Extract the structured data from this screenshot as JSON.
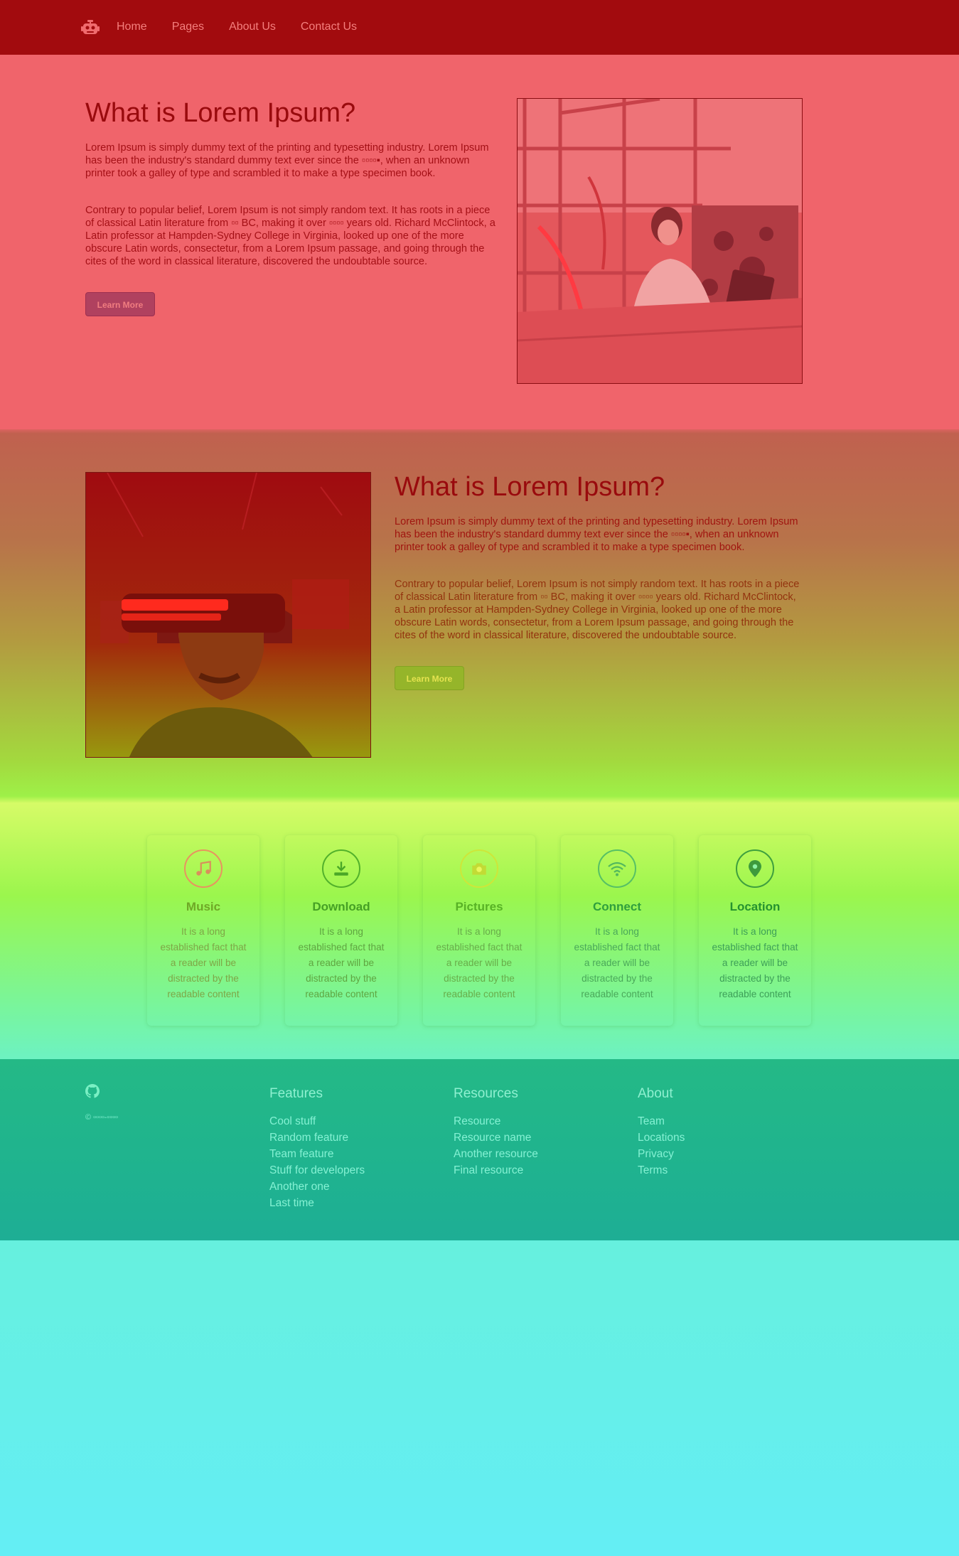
{
  "nav": {
    "logo_icon": "robot-icon",
    "items": [
      {
        "label": "Home"
      },
      {
        "label": "Pages"
      },
      {
        "label": "About Us"
      },
      {
        "label": "Contact Us"
      }
    ]
  },
  "section1": {
    "title": "What is Lorem Ipsum?",
    "p1": "Lorem Ipsum is simply dummy text of the printing and typesetting industry. Lorem Ipsum has been the industry's standard dummy text ever since the ▫▫▫▫▪, when an unknown printer took a galley of type and scrambled it to make a type specimen book.",
    "p2": "Contrary to popular belief, Lorem Ipsum is not simply random text. It has roots in a piece of classical Latin literature from ▫▫ BC, making it over ▫▫▫▫ years old. Richard McClintock, a Latin professor at Hampden-Sydney College in Virginia, looked up one of the more obscure Latin words, consectetur, from a Lorem Ipsum passage, and going through the cites of the word in classical literature, discovered the undoubtable source.",
    "button": "Learn More",
    "image": "lab-engineer-photo"
  },
  "section2": {
    "title": "What is Lorem Ipsum?",
    "p1": "Lorem Ipsum is simply dummy text of the printing and typesetting industry. Lorem Ipsum has been the industry's standard dummy text ever since the ▫▫▫▫▪, when an unknown printer took a galley of type and scrambled it to make a type specimen book.",
    "p2": "Contrary to popular belief, Lorem Ipsum is not simply random text. It has roots in a piece of classical Latin literature from ▫▫ BC, making it over ▫▫▫▫ years old. Richard McClintock, a Latin professor at Hampden-Sydney College in Virginia, looked up one of the more obscure Latin words, consectetur, from a Lorem Ipsum passage, and going through the cites of the word in classical literature, discovered the undoubtable source.",
    "button": "Learn More",
    "image": "vr-headset-photo"
  },
  "features": [
    {
      "icon": "music-icon",
      "title": "Music",
      "desc": "It is a long established fact that a reader will be distracted by the readable content"
    },
    {
      "icon": "download-icon",
      "title": "Download",
      "desc": "It is a long established fact that a reader will be distracted by the readable content"
    },
    {
      "icon": "camera-icon",
      "title": "Pictures",
      "desc": "It is a long established fact that a reader will be distracted by the readable content"
    },
    {
      "icon": "wifi-icon",
      "title": "Connect",
      "desc": "It is a long established fact that a reader will be distracted by the readable content"
    },
    {
      "icon": "map-pin-icon",
      "title": "Location",
      "desc": "It is a long established fact that a reader will be distracted by the readable content"
    }
  ],
  "footer": {
    "logo_icon": "github-icon",
    "copyright": "© ▫▫▫▫-▫▫▫▫",
    "columns": [
      {
        "title": "Features",
        "links": [
          "Cool stuff",
          "Random feature",
          "Team feature",
          "Stuff for developers",
          "Another one",
          "Last time"
        ]
      },
      {
        "title": "Resources",
        "links": [
          "Resource",
          "Resource name",
          "Another resource",
          "Final resource"
        ]
      },
      {
        "title": "About",
        "links": [
          "Team",
          "Locations",
          "Privacy",
          "Terms"
        ]
      }
    ]
  },
  "colors": {
    "nav_bg": "#a20b0e",
    "section1_bg": "#f0646b",
    "footer_bg": "#1fb38f"
  }
}
